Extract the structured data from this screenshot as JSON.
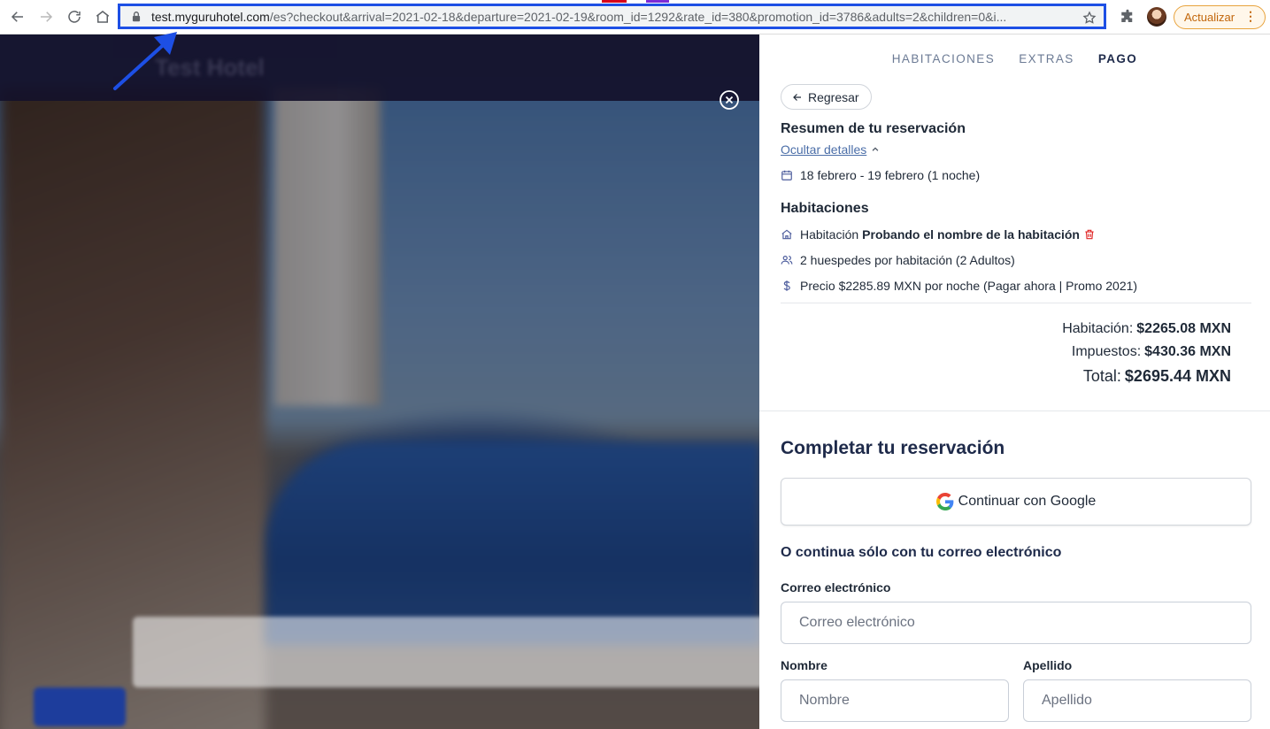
{
  "browser": {
    "url_host": "test.myguruhotel.com",
    "url_rest": "/es?checkout&arrival=2021-02-18&departure=2021-02-19&room_id=1292&rate_id=380&promotion_id=3786&adults=2&children=0&i...",
    "update_label": "Actualizar",
    "update_menu_glyph": "⋮",
    "highlight_color": "#1d4fe5"
  },
  "background_page": {
    "hotel_name": "Test Hotel"
  },
  "checkout": {
    "steps": [
      {
        "label": "HABITACIONES",
        "active": false
      },
      {
        "label": "EXTRAS",
        "active": false
      },
      {
        "label": "PAGO",
        "active": true
      }
    ],
    "back_label": "Regresar",
    "summary_title": "Resumen de tu reservación",
    "hide_details": "Ocultar detalles",
    "dates": "18 febrero - 19 febrero (1 noche)",
    "rooms_title": "Habitaciones",
    "room_prefix": "Habitación",
    "room_name": "Probando el nombre de la habitación",
    "guests": "2 huespedes por habitación (2 Adultos)",
    "price": "Precio $2285.89 MXN por noche (Pagar ahora | Promo 2021)",
    "totals": {
      "room_label": "Habitación:",
      "room_value": "$2265.08 MXN",
      "tax_label": "Impuestos:",
      "tax_value": "$430.36 MXN",
      "total_label": "Total:",
      "total_value": "$2695.44 MXN"
    },
    "complete_title": "Completar tu reservación",
    "google_label": "Continuar con Google",
    "or_email": "O continua sólo con tu correo electrónico",
    "email_label": "Correo electrónico",
    "email_placeholder": "Correo electrónico",
    "first_name_label": "Nombre",
    "first_name_placeholder": "Nombre",
    "last_name_label": "Apellido",
    "last_name_placeholder": "Apellido"
  },
  "icons": {
    "back": "arrow-left-icon",
    "forward": "arrow-right-icon",
    "reload": "reload-icon",
    "home": "home-icon",
    "lock": "lock-icon",
    "star": "star-icon",
    "extensions": "puzzle-icon",
    "close": "close-circle-icon",
    "calendar": "calendar-icon",
    "room": "house-icon",
    "guests": "users-icon",
    "price": "dollar-icon",
    "delete": "trash-icon",
    "google": "google-icon"
  }
}
